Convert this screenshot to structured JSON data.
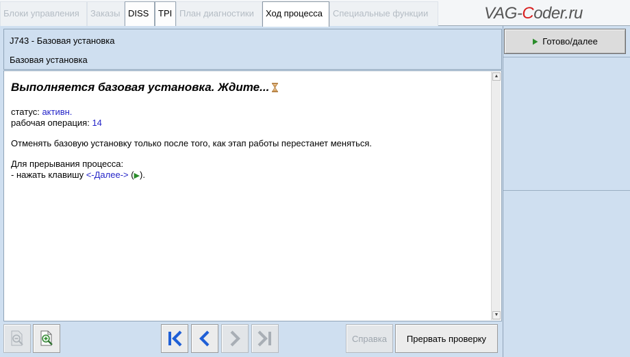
{
  "tabs": [
    {
      "label": "Блоки управления",
      "state": "disabled"
    },
    {
      "label": "Заказы",
      "state": "disabled"
    },
    {
      "label": "DISS",
      "state": "enabled"
    },
    {
      "label": "TPI",
      "state": "enabled"
    },
    {
      "label": "План диагностики",
      "state": "disabled"
    },
    {
      "label": "Ход процесса",
      "state": "active"
    },
    {
      "label": "Специальные функции",
      "state": "disabled"
    }
  ],
  "watermark": {
    "part1": "VAG-",
    "part2": "C",
    "part3": "oder.ru"
  },
  "header": {
    "line1": "J743 - Базовая установка",
    "line2": "Базовая установка"
  },
  "content": {
    "headline": "Выполняется базовая установка. Ждите...",
    "status_label": "статус: ",
    "status_value": "активн.",
    "operation_label": "рабочая операция: ",
    "operation_value": "14",
    "note": "Отменять базовую установку только после того, как этап работы перестанет меняться.",
    "interrupt_title": "Для прерывания процесса:",
    "interrupt_prefix": "- нажать клавишу ",
    "interrupt_key": "<-Далее->",
    "interrupt_open": " (",
    "interrupt_close": ")."
  },
  "right_panel": {
    "done_button": "Готово/далее"
  },
  "toolbar": {
    "help_button": "Справка",
    "abort_button": "Прервать проверку"
  },
  "colors": {
    "accent_blue": "#2424c8",
    "nav_blue": "#1f5fd6",
    "play_green": "#2a8c2a",
    "watermark_red": "#d81e1e",
    "panel_bg": "#cfdff0"
  },
  "icons": {
    "hourglass": "hourglass-icon",
    "play": "play-icon",
    "zoom_out": "zoom-out-icon",
    "zoom_in_document": "zoom-in-document-icon",
    "first": "skip-to-first-icon",
    "previous": "chevron-left-icon",
    "next": "chevron-right-icon",
    "last": "skip-to-last-icon"
  }
}
